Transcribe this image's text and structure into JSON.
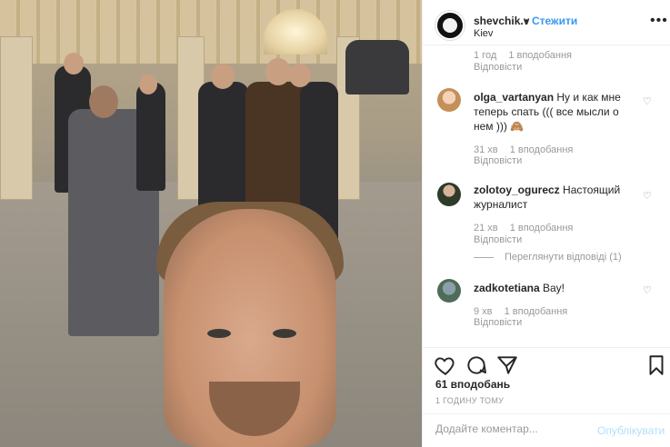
{
  "post": {
    "username": "shevchik.v",
    "separator": "•",
    "follow_label": "Стежити",
    "location": "Kiev",
    "more_icon": "more-options-icon"
  },
  "comments": {
    "top_meta": {
      "time": "1 год",
      "likes": "1 вподобання",
      "reply": "Відповісти"
    },
    "items": [
      {
        "username": "olga_vartanyan",
        "text": "Ну и как мне теперь спать ((( все мысли о нем ))) 🙈",
        "time": "31 хв",
        "likes": "1 вподобання",
        "reply": "Відповісти"
      },
      {
        "username": "zolotoy_ogurecz",
        "text": "Настоящий журналист",
        "time": "21 хв",
        "likes": "1 вподобання",
        "reply": "Відповісти",
        "view_replies": "Переглянути відповіді (1)"
      },
      {
        "username": "zadkotetiana",
        "text": "Вау!",
        "time": "9 хв",
        "likes": "1 вподобання",
        "reply": "Відповісти"
      }
    ]
  },
  "actions": {
    "like_icon": "heart-icon",
    "comment_icon": "comment-icon",
    "share_icon": "share-icon",
    "save_icon": "bookmark-icon",
    "likes": "61 вподобань",
    "time_ago": "1 ГОДИНУ ТОМУ"
  },
  "compose": {
    "placeholder": "Додайте коментар...",
    "post_label": "Опублікувати"
  },
  "colors": {
    "accent": "#3897f0",
    "post_disabled": "#b2dffc",
    "muted": "#999999"
  }
}
